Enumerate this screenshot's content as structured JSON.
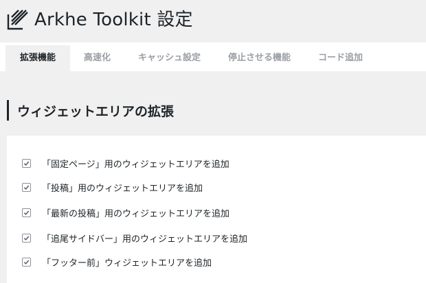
{
  "header": {
    "title": "Arkhe Toolkit 設定",
    "logo_icon": "arkhe-logo-icon"
  },
  "tabs": [
    {
      "label": "拡張機能",
      "active": true
    },
    {
      "label": "高速化",
      "active": false
    },
    {
      "label": "キャッシュ設定",
      "active": false
    },
    {
      "label": "停止させる機能",
      "active": false
    },
    {
      "label": "コード追加",
      "active": false
    }
  ],
  "section": {
    "title": "ウィジェットエリアの拡張"
  },
  "options": [
    {
      "label": "「固定ページ」用のウィジェットエリアを追加",
      "checked": true
    },
    {
      "label": "「投稿」用のウィジェットエリアを追加",
      "checked": true
    },
    {
      "label": "「最新の投稿」用のウィジェットエリアを追加",
      "checked": true
    },
    {
      "label": "「追尾サイドバー」用のウィジェットエリアを追加",
      "checked": true
    },
    {
      "label": "「フッター前」ウィジェットエリアを追加",
      "checked": true
    }
  ],
  "colors": {
    "background": "#f0f0f1",
    "panel": "#ffffff",
    "text": "#1d2327",
    "inactive_tab": "#9a9fa5",
    "checkbox_border": "#8c8f94"
  }
}
